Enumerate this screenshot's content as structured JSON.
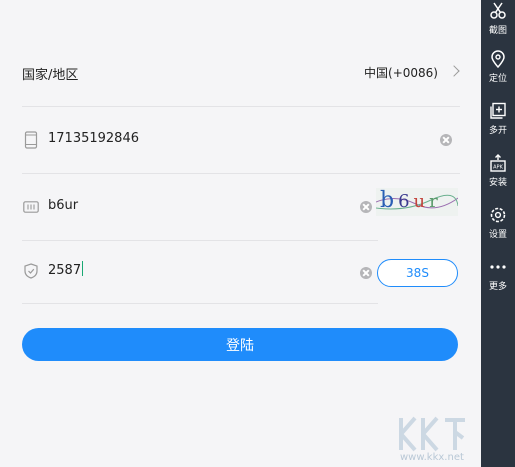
{
  "form": {
    "region": {
      "label": "国家/地区",
      "value": "中国(+0086)"
    },
    "phone": {
      "value": "17135192846"
    },
    "captcha": {
      "value": "b6ur",
      "image_text": "b6ur"
    },
    "sms_code": {
      "value": "2587",
      "countdown": "38S"
    },
    "login_label": "登陆"
  },
  "sidebar": {
    "items": [
      {
        "label": "截图",
        "icon": "scissors-icon"
      },
      {
        "label": "定位",
        "icon": "location-pin-icon"
      },
      {
        "label": "多开",
        "icon": "multi-open-icon"
      },
      {
        "label": "安装",
        "icon": "apk-install-icon"
      },
      {
        "label": "设置",
        "icon": "gear-icon"
      },
      {
        "label": "更多",
        "icon": "more-dots-icon"
      }
    ]
  },
  "watermark": {
    "text": "www.kkx.net"
  },
  "colors": {
    "accent": "#1f8cfb",
    "sidebar": "#2b3440",
    "background": "#f5f5f7"
  }
}
